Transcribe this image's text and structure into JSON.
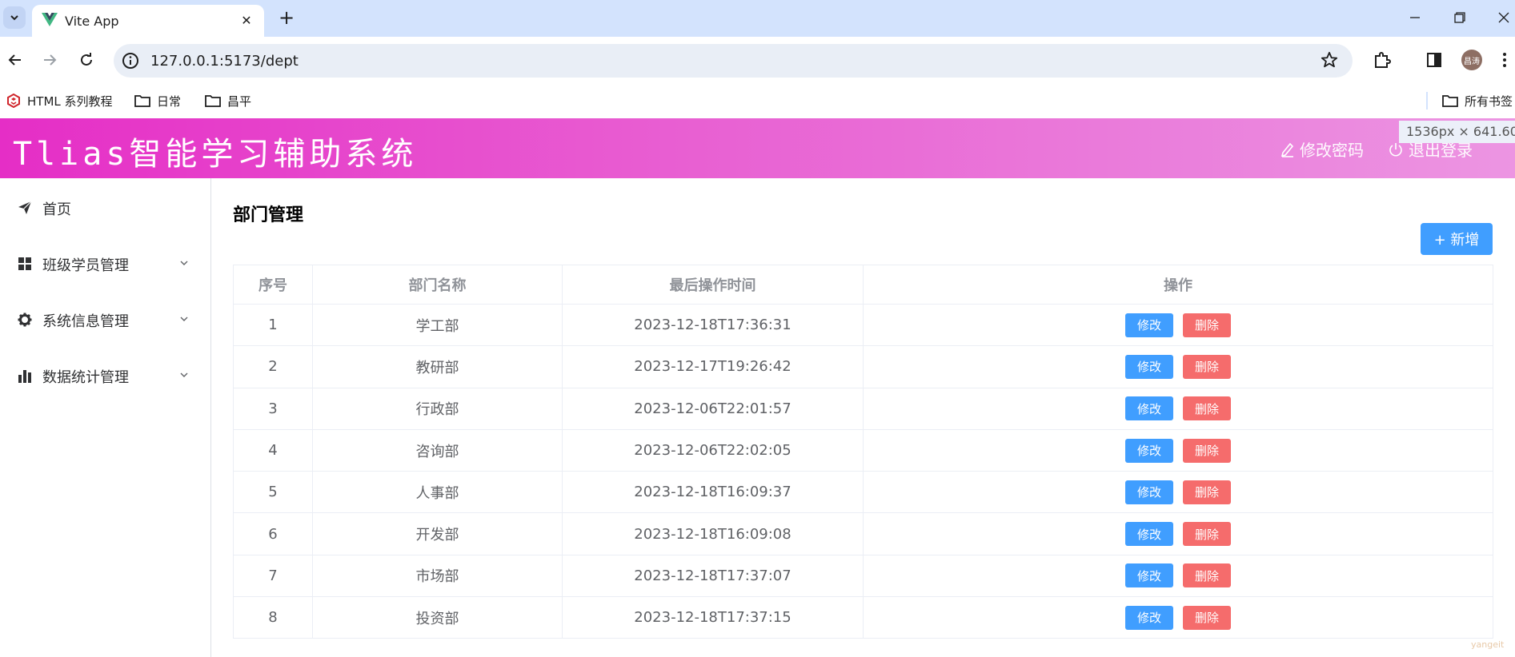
{
  "browser": {
    "tab_title": "Vite App",
    "url": "127.0.0.1:5173/dept",
    "avatar_text": "昌涛",
    "bookmarks": [
      {
        "label": "HTML 系列教程",
        "icon": "html-logo-icon"
      },
      {
        "label": "日常",
        "icon": "folder-icon"
      },
      {
        "label": "昌平",
        "icon": "folder-icon"
      }
    ],
    "all_bookmarks_label": "所有书签"
  },
  "devtools": {
    "size_tip": "1536px × 641.60px"
  },
  "header": {
    "title": "Tlias智能学习辅助系统",
    "change_password": "修改密码",
    "logout": "退出登录"
  },
  "sidebar": {
    "items": [
      {
        "label": "首页",
        "icon": "paper-plane-icon",
        "has_submenu": false
      },
      {
        "label": "班级学员管理",
        "icon": "grid-icon",
        "has_submenu": true
      },
      {
        "label": "系统信息管理",
        "icon": "gear-icon",
        "has_submenu": true
      },
      {
        "label": "数据统计管理",
        "icon": "bar-chart-icon",
        "has_submenu": true
      }
    ]
  },
  "main": {
    "page_title": "部门管理",
    "add_button": "+ 新增",
    "table": {
      "headers": [
        "序号",
        "部门名称",
        "最后操作时间",
        "操作"
      ],
      "edit_label": "修改",
      "delete_label": "删除",
      "rows": [
        {
          "index": "1",
          "name": "学工部",
          "time": "2023-12-18T17:36:31"
        },
        {
          "index": "2",
          "name": "教研部",
          "time": "2023-12-17T19:26:42"
        },
        {
          "index": "3",
          "name": "行政部",
          "time": "2023-12-06T22:01:57"
        },
        {
          "index": "4",
          "name": "咨询部",
          "time": "2023-12-06T22:02:05"
        },
        {
          "index": "5",
          "name": "人事部",
          "time": "2023-12-18T16:09:37"
        },
        {
          "index": "6",
          "name": "开发部",
          "time": "2023-12-18T16:09:08"
        },
        {
          "index": "7",
          "name": "市场部",
          "time": "2023-12-18T17:37:07"
        },
        {
          "index": "8",
          "name": "投资部",
          "time": "2023-12-18T17:37:15"
        }
      ]
    }
  },
  "watermark": "yangeit",
  "colors": {
    "header_gradient_start": "#e52ec6",
    "header_gradient_end": "#ec95e2",
    "primary": "#409eff",
    "danger": "#f56c6c"
  }
}
